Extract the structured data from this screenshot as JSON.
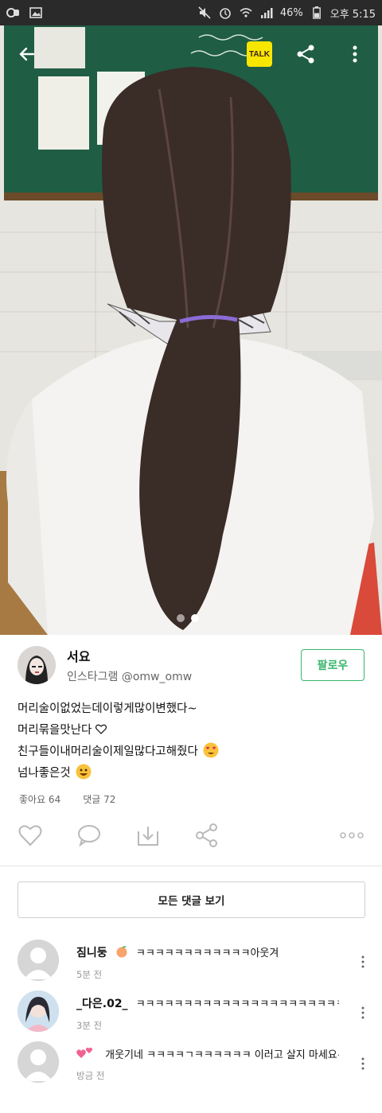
{
  "status_bar": {
    "battery": "46%",
    "time": "오후 5:15",
    "icons": [
      "notification-icon",
      "gallery-icon",
      "mute-icon",
      "alarm-icon",
      "wifi-icon",
      "signal-icon",
      "battery-icon"
    ]
  },
  "nav": {
    "back_icon": "back-arrow-icon",
    "kakao_talk_label": "TALK",
    "share_icon": "share-icon",
    "more_icon": "more-vertical-icon"
  },
  "carousel": {
    "count": 2,
    "active_index": 1
  },
  "author": {
    "name": "서요",
    "handle": "인스타그램 @omw_omw",
    "follow_label": "팔로우"
  },
  "caption": {
    "lines": [
      "머리술이없었는데이렇게많이변했다~",
      "머리묶을맛난다",
      "친구들이내머리술이제일많다고해줬다",
      "넘나좋은것"
    ]
  },
  "counts": {
    "likes": "좋아요 64",
    "comments": "댓글 72"
  },
  "actions": [
    "heart-icon",
    "comment-icon",
    "download-icon",
    "share-icon",
    "more-horizontal-icon"
  ],
  "all_comments_label": "모든 댓글 보기",
  "comments": [
    {
      "user": "짐니둥",
      "text": "ㅋㅋㅋㅋㅋㅋㅋㅋㅋㅋㅋㅋ아웃겨",
      "time": "5분 전"
    },
    {
      "user": "_다은.02_",
      "text": "ㅋㅋㅋㅋㅋㅋㅋㅋㅋㅋㅋㅋㅋㅋㅋㅋㅋㅋㅋㅋㅋㅋㅋㅋㅋㅋㅋㅋㅋㅋㅋ",
      "time": "3분 전"
    },
    {
      "user": "",
      "text": "개웃기네 ㅋㅋㅋㅋㄱㅋㅋㅋㅋㅋㅋ 이러고 살지 마세요~ㅋㅋㅋ",
      "time": "방금 전"
    }
  ],
  "colors": {
    "accent": "#38b56b",
    "status_bar": "#2a2a2a",
    "kakao_yellow": "#f7e600"
  }
}
